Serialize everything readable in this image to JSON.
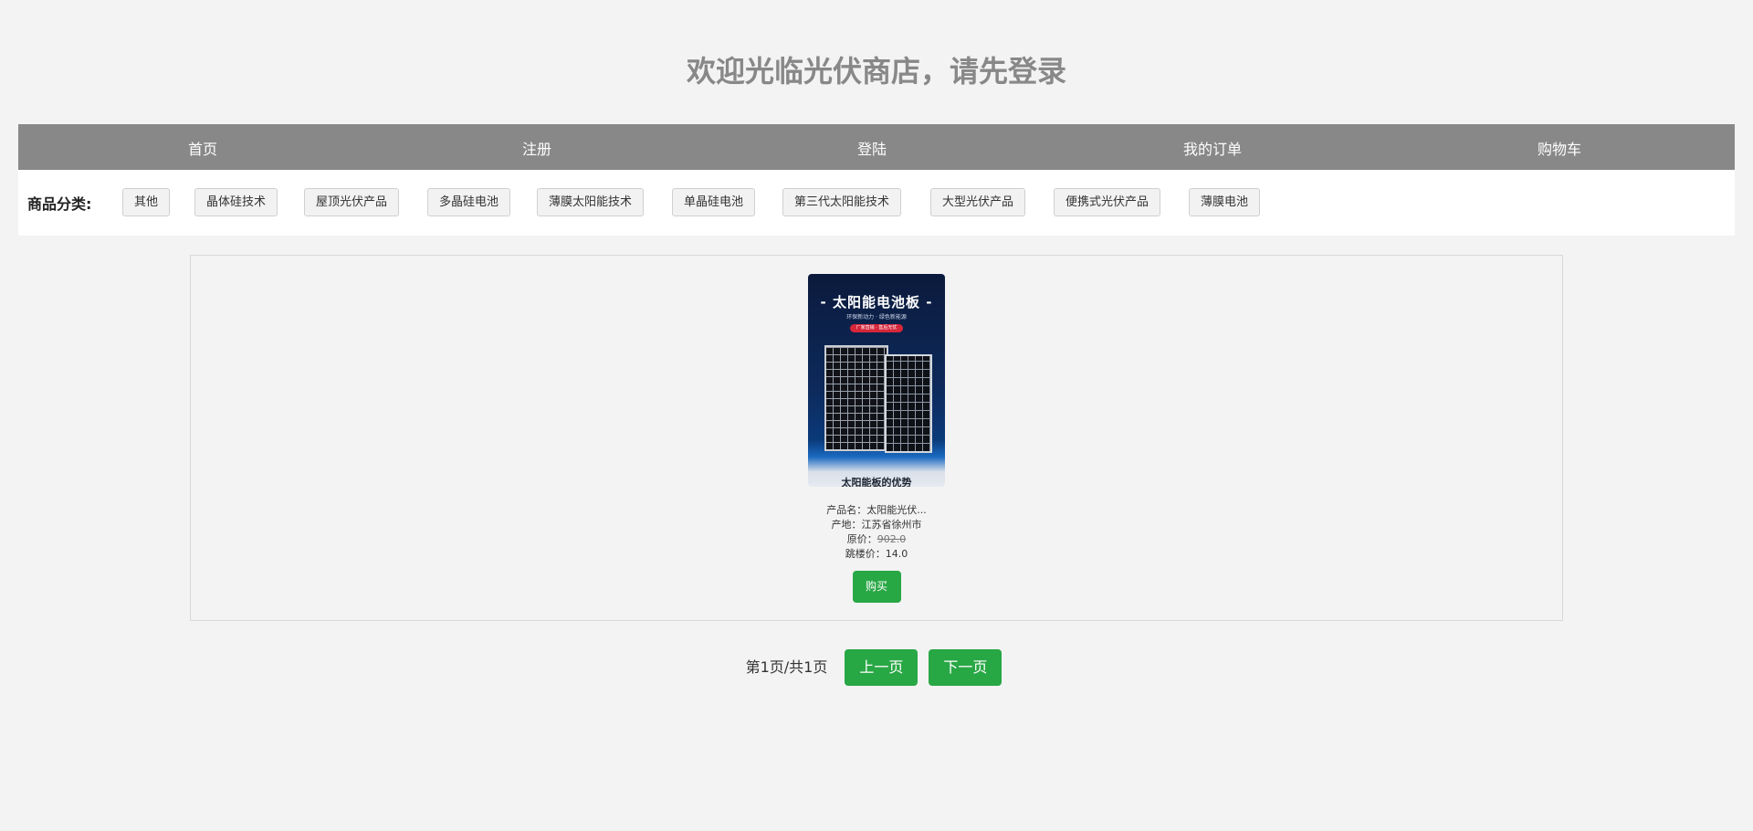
{
  "header": {
    "title": "欢迎光临光伏商店，请先登录"
  },
  "nav": {
    "items": [
      {
        "label": "首页"
      },
      {
        "label": "注册"
      },
      {
        "label": "登陆"
      },
      {
        "label": "我的订单"
      },
      {
        "label": "购物车"
      }
    ]
  },
  "categories": {
    "label": "商品分类:",
    "items": [
      {
        "label": "其他"
      },
      {
        "label": "晶体硅技术"
      },
      {
        "label": "屋顶光伏产品"
      },
      {
        "label": "多晶硅电池"
      },
      {
        "label": "薄膜太阳能技术"
      },
      {
        "label": "单晶硅电池"
      },
      {
        "label": "第三代太阳能技术"
      },
      {
        "label": "大型光伏产品"
      },
      {
        "label": "便携式光伏产品"
      },
      {
        "label": "薄膜电池"
      }
    ]
  },
  "products": [
    {
      "image": {
        "headline": "- 太阳能电池板 -",
        "subline": "环保新动力 · 绿色新能源",
        "tag": "厂家直销 · 售后无忧",
        "caption": "太阳能板的优势"
      },
      "name_label": "产品名：",
      "name": "太阳能光伏...",
      "origin_label": "产地：",
      "origin": "江苏省徐州市",
      "original_price_label": "原价：",
      "original_price": "902.0",
      "flash_price_label": "跳楼价：",
      "flash_price": "14.0",
      "buy_label": "购买"
    }
  ],
  "pagination": {
    "info": "第1页/共1页",
    "prev_label": "上一页",
    "next_label": "下一页"
  },
  "colors": {
    "background": "#f3f3f3",
    "nav_bar": "#888888",
    "title_text": "#888888",
    "accent_green": "#28a745"
  }
}
